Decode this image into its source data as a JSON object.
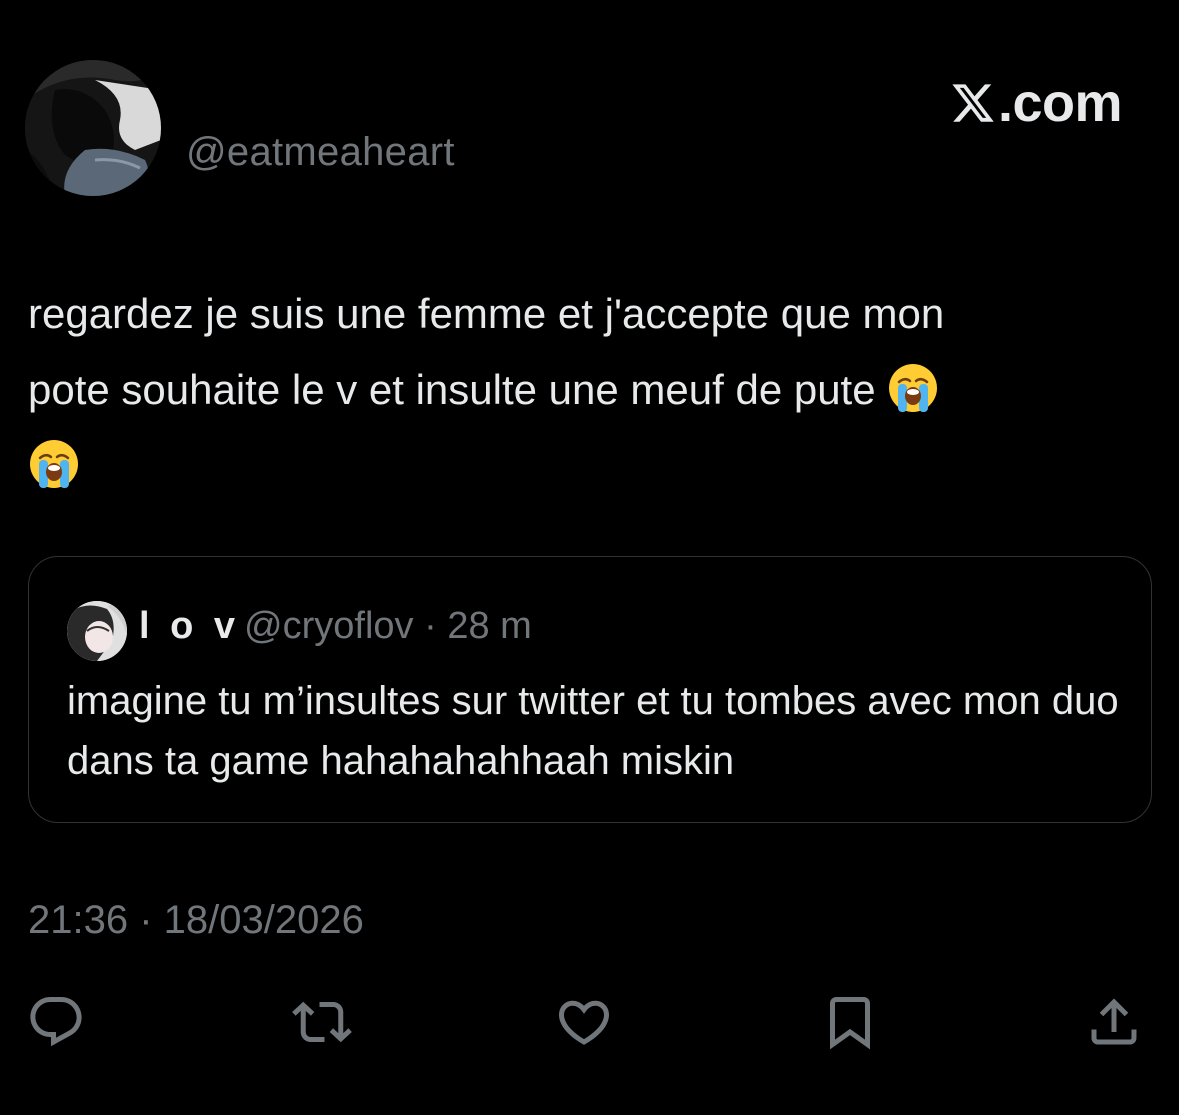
{
  "author": {
    "handle": "@eatmeaheart",
    "avatar": "profile-photo"
  },
  "brand": {
    "text": ".com",
    "icon": "x-logo"
  },
  "tweet": {
    "text_line1": "regardez je suis une femme et j'accepte que mon",
    "text_line2": "pote souhaite le v et insulte une meuf de pute",
    "emoji": "loudly-crying-face"
  },
  "quote": {
    "name": "l o v",
    "handle": "@cryoflov",
    "separator": " · ",
    "time": "28 m",
    "text": "imagine tu m’insultes sur twitter et tu tombes avec mon duo dans ta game hahahahahhaah miskin"
  },
  "timestamp": "21:36 · 18/03/2026",
  "actions": {
    "reply_icon": "reply-icon",
    "retweet_icon": "retweet-icon",
    "like_icon": "heart-icon",
    "bookmark_icon": "bookmark-icon",
    "share_icon": "share-icon"
  },
  "colors": {
    "background": "#000000",
    "text": "#e7e9ea",
    "secondary": "#71767b",
    "border": "#2f3336"
  }
}
